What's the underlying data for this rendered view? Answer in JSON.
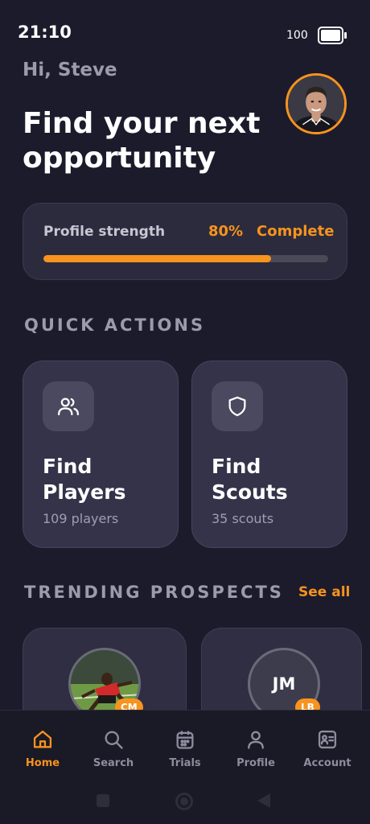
{
  "status_bar": {
    "time": "21:10",
    "battery": "100"
  },
  "header": {
    "greeting": "Hi, Steve",
    "headline": "Find your next opportunity"
  },
  "profile_strength": {
    "label": "Profile strength",
    "percent_text": "80%",
    "status": "Complete",
    "progress": 0.8
  },
  "quick_actions": {
    "title": "QUICK ACTIONS",
    "items": [
      {
        "title": "Find Players",
        "subtitle": "109 players",
        "icon": "users-icon"
      },
      {
        "title": "Find Scouts",
        "subtitle": "35 scouts",
        "icon": "shield-icon"
      }
    ]
  },
  "trending": {
    "title": "TRENDING PROSPECTS",
    "see_all": "See all",
    "items": [
      {
        "position": "CM",
        "photo": "player-photo"
      },
      {
        "initials": "JM",
        "position": "LB"
      }
    ]
  },
  "bottom_nav": {
    "items": [
      {
        "label": "Home",
        "icon": "home-icon",
        "active": true
      },
      {
        "label": "Search",
        "icon": "search-icon",
        "active": false
      },
      {
        "label": "Trials",
        "icon": "calendar-icon",
        "active": false
      },
      {
        "label": "Profile",
        "icon": "person-icon",
        "active": false
      },
      {
        "label": "Account",
        "icon": "id-card-icon",
        "active": false
      }
    ]
  },
  "colors": {
    "accent": "#f7931e",
    "background": "#1c1b2c",
    "card": "#34334a"
  }
}
